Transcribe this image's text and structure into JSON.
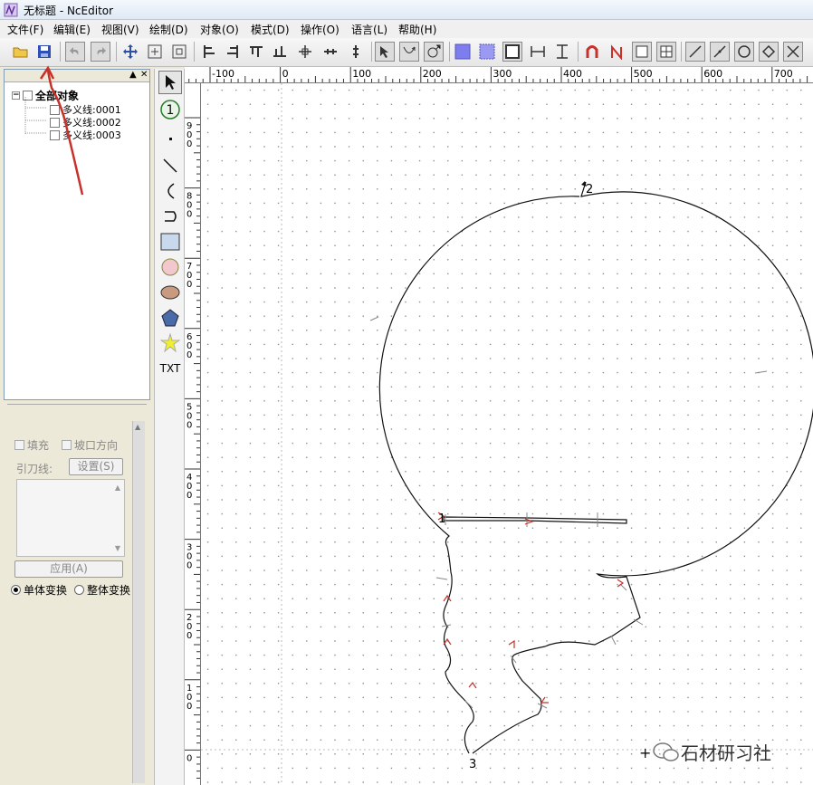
{
  "window": {
    "title": "无标题 - NcEditor"
  },
  "menu": [
    {
      "label": "文件(F)"
    },
    {
      "label": "编辑(E)"
    },
    {
      "label": "视图(V)"
    },
    {
      "label": "绘制(D)"
    },
    {
      "label": "对象(O)"
    },
    {
      "label": "模式(D)"
    },
    {
      "label": "操作(O)"
    },
    {
      "label": "语言(L)"
    },
    {
      "label": "帮助(H)"
    }
  ],
  "toolbar": {
    "icons": [
      "open-icon",
      "save-icon",
      "undo-icon",
      "redo-icon",
      "move-icon",
      "zoom-window-icon",
      "zoom-fit-icon",
      "align-left-icon",
      "align-right-icon",
      "align-top-icon",
      "align-bottom-icon",
      "align-center-icon",
      "align-hcenter-icon",
      "align-vcenter-icon",
      "pick-start-icon",
      "reverse-direction-icon",
      "set-start-icon",
      "fill-icon",
      "dotted-fill-icon",
      "outline-icon",
      "dimension-h-icon",
      "dimension-v-icon",
      "magnet-icon",
      "lead-icon",
      "blank-icon",
      "grid-icon",
      "line-tool-icon",
      "polyline-tool-icon",
      "circle-tool-icon",
      "node-tool-icon",
      "break-icon"
    ]
  },
  "object_tree": {
    "root": "全部对象",
    "items": [
      {
        "label": "多义线:0001"
      },
      {
        "label": "多义线:0002"
      },
      {
        "label": "多义线:0003"
      }
    ]
  },
  "properties": {
    "fill_label": "填充",
    "slope_label": "坡口方向",
    "lead_label": "引刀线:",
    "settings_button": "设置(S)",
    "apply_button": "应用(A)",
    "single_transform": "单体变换",
    "whole_transform": "整体变换"
  },
  "toolbox": {
    "text_tool": "TXT",
    "number_tool": "1"
  },
  "ruler": {
    "h_labels": [
      "-100",
      "0",
      "100",
      "200",
      "300",
      "400",
      "500",
      "600",
      "700"
    ],
    "v_labels": [
      "900",
      "800",
      "700",
      "600",
      "500",
      "400",
      "300",
      "200",
      "100",
      "0"
    ]
  },
  "drawing": {
    "markers": [
      "1",
      "2",
      "3"
    ]
  },
  "watermark": {
    "text": "石材研习社"
  },
  "colors": {
    "accent": "#3a5fd0",
    "annotation": "#c8302a",
    "fill_blue": "#7d7dee"
  }
}
